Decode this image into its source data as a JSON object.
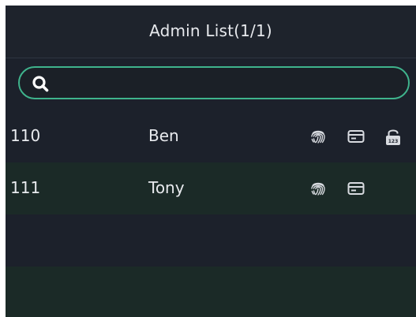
{
  "header": {
    "title": "Admin List(1/1)"
  },
  "search": {
    "value": "",
    "placeholder": "",
    "icon": "search-icon"
  },
  "admins": [
    {
      "id": "110",
      "name": "Ben",
      "credentials": [
        "fingerprint-icon",
        "card-icon",
        "password-lock-icon"
      ]
    },
    {
      "id": "111",
      "name": "Tony",
      "credentials": [
        "fingerprint-icon",
        "card-icon"
      ]
    }
  ],
  "colors": {
    "accent": "#3fb38c",
    "background": "#1c212b",
    "row_alt": "#1b2a27",
    "text": "#e8eaee"
  }
}
